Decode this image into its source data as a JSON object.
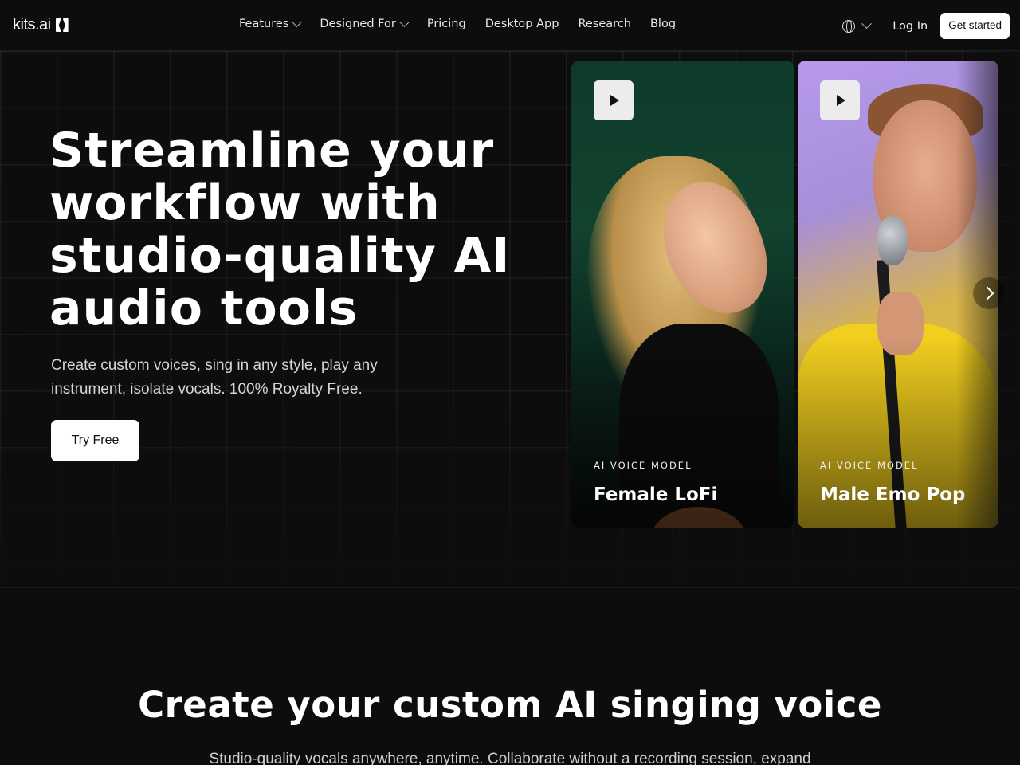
{
  "nav": {
    "logo_text": "kits.ai",
    "links": [
      {
        "label": "Features",
        "dropdown": true
      },
      {
        "label": "Designed For",
        "dropdown": true
      },
      {
        "label": "Pricing",
        "dropdown": false
      },
      {
        "label": "Desktop App",
        "dropdown": false
      },
      {
        "label": "Research",
        "dropdown": false
      },
      {
        "label": "Blog",
        "dropdown": false
      }
    ],
    "language_icon": "globe-icon",
    "login_label": "Log In",
    "cta_label": "Get started"
  },
  "hero": {
    "title": "Streamline your workflow with studio-quality AI audio tools",
    "subtitle": "Create custom voices, sing in any style, play any instrument, isolate vocals. 100% Royalty Free.",
    "cta_label": "Try Free",
    "cards": [
      {
        "kicker": "AI VOICE MODEL",
        "name": "Female LoFi",
        "play_icon": "play-icon"
      },
      {
        "kicker": "AI VOICE MODEL",
        "name": "Male Emo Pop",
        "play_icon": "play-icon"
      }
    ],
    "next_icon": "chevron-right-icon"
  },
  "section": {
    "title": "Create your custom AI singing voice",
    "subtitle": "Studio-quality vocals anywhere, anytime. Collaborate without a recording session, expand"
  },
  "colors": {
    "background": "#0d0d0e",
    "button_bg": "#ffffff",
    "card1_bg": "#0f3a2a",
    "card2_bg": "#b799ec"
  }
}
